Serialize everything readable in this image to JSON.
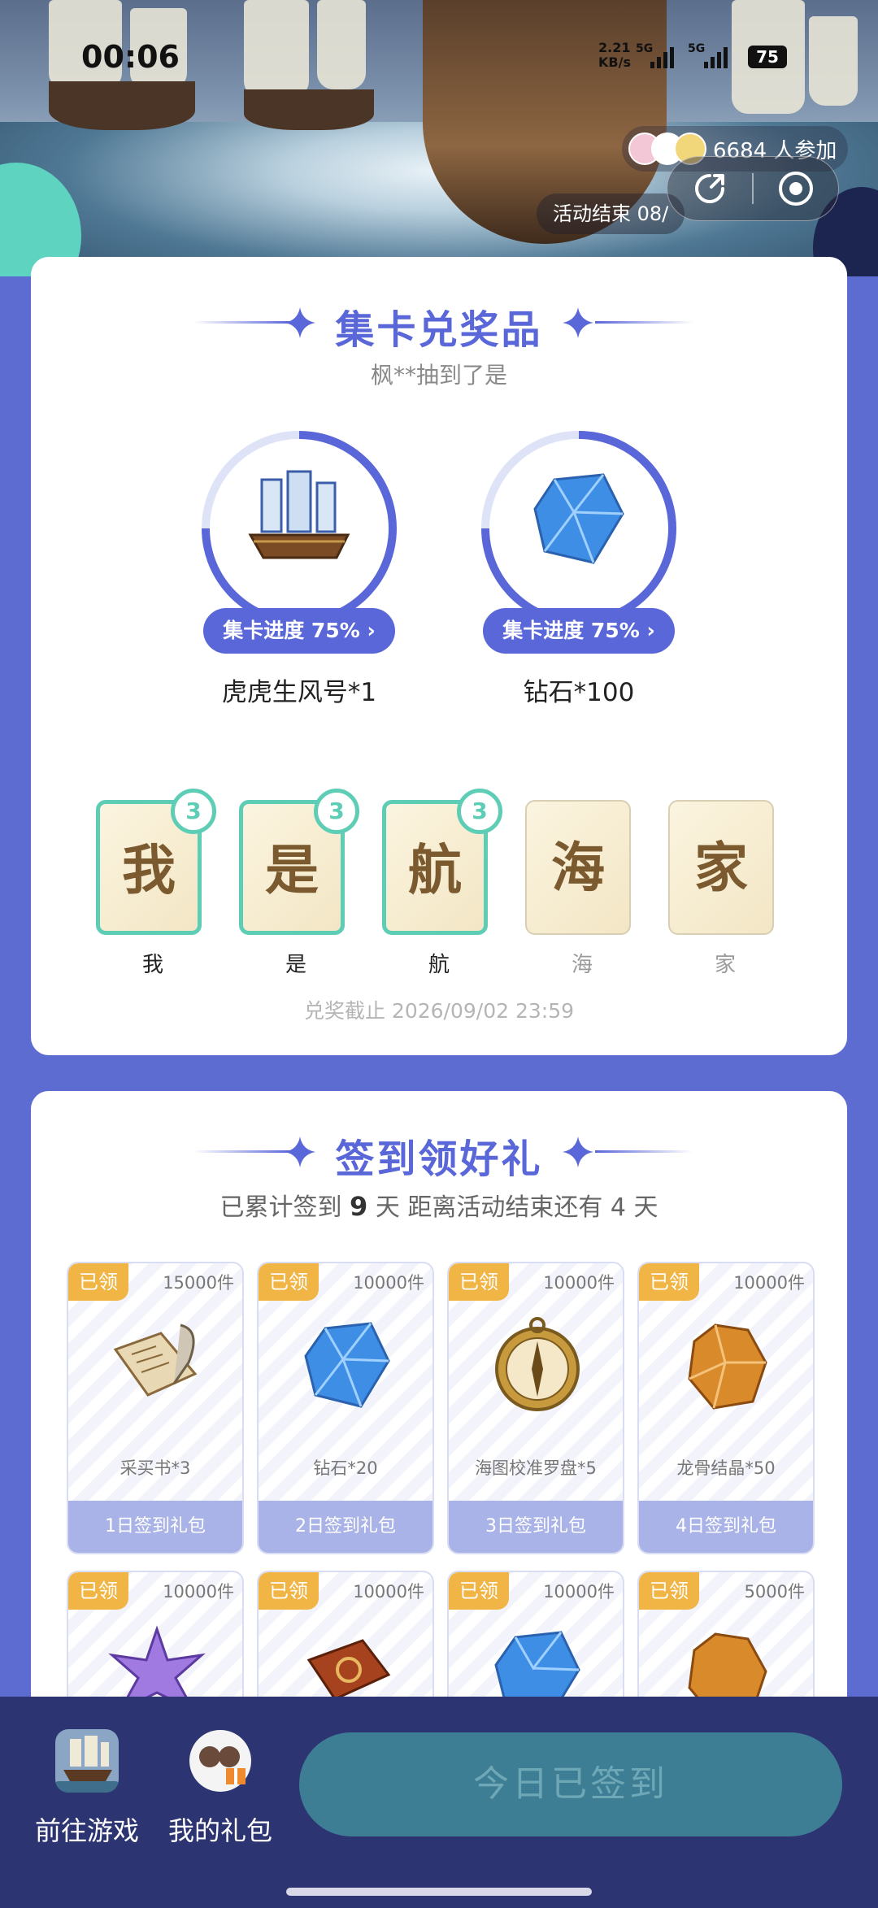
{
  "status_bar": {
    "time": "00:06",
    "net_speed_value": "2.21",
    "net_speed_unit": "KB/s",
    "signal1": "5G",
    "signal2": "5G",
    "battery": "75"
  },
  "header": {
    "participants": "6684 人参加",
    "activity_end": "活动结束 08/"
  },
  "collect": {
    "title": "集卡兑奖品",
    "ticker": "枫**抽到了是",
    "prizes": [
      {
        "progress_label": "集卡进度 75%",
        "progress": 0.75,
        "name": "虎虎生风号*1",
        "icon": "galleon-ship-icon"
      },
      {
        "progress_label": "集卡进度 75%",
        "progress": 0.75,
        "name": "钻石*100",
        "icon": "blue-diamond-icon"
      }
    ],
    "cards": [
      {
        "glyph": "我",
        "label": "我",
        "count": "3",
        "collected": true
      },
      {
        "glyph": "是",
        "label": "是",
        "count": "3",
        "collected": true
      },
      {
        "glyph": "航",
        "label": "航",
        "count": "3",
        "collected": true
      },
      {
        "glyph": "海",
        "label": "海",
        "collected": false
      },
      {
        "glyph": "家",
        "label": "家",
        "collected": false
      }
    ],
    "deadline": "兑奖截止 2026/09/02 23:59"
  },
  "signin": {
    "title": "签到领好礼",
    "info_prefix": "已累计签到",
    "days": "9",
    "info_mid": "天  距离活动结束还有",
    "remain": "4",
    "info_suffix": "天",
    "rewards": [
      {
        "status": "已领",
        "stock": "15000件",
        "name": "采买书*3",
        "day": "1日签到礼包",
        "icon": "scroll-quill-icon"
      },
      {
        "status": "已领",
        "stock": "10000件",
        "name": "钻石*20",
        "day": "2日签到礼包",
        "icon": "blue-diamond-icon"
      },
      {
        "status": "已领",
        "stock": "10000件",
        "name": "海图校准罗盘*5",
        "day": "3日签到礼包",
        "icon": "compass-icon"
      },
      {
        "status": "已领",
        "stock": "10000件",
        "name": "龙骨结晶*50",
        "day": "4日签到礼包",
        "icon": "amber-crystal-icon"
      },
      {
        "status": "已领",
        "stock": "10000件",
        "icon": "purple-star-crystal-icon"
      },
      {
        "status": "已领",
        "stock": "10000件",
        "icon": "red-book-icon"
      },
      {
        "status": "已领",
        "stock": "10000件",
        "icon": "blue-diamond-icon"
      },
      {
        "status": "已领",
        "stock": "5000件",
        "icon": "amber-crystal-icon"
      }
    ]
  },
  "bottom": {
    "go_game": "前往游戏",
    "my_gifts": "我的礼包",
    "signed_button": "今日已签到"
  },
  "colors": {
    "accent": "#5a67d8",
    "teal": "#5ecdb5",
    "claimed_badge": "#f1b545",
    "page_bg": "#5d6cd1",
    "bottom_bar": "#2c3572"
  }
}
